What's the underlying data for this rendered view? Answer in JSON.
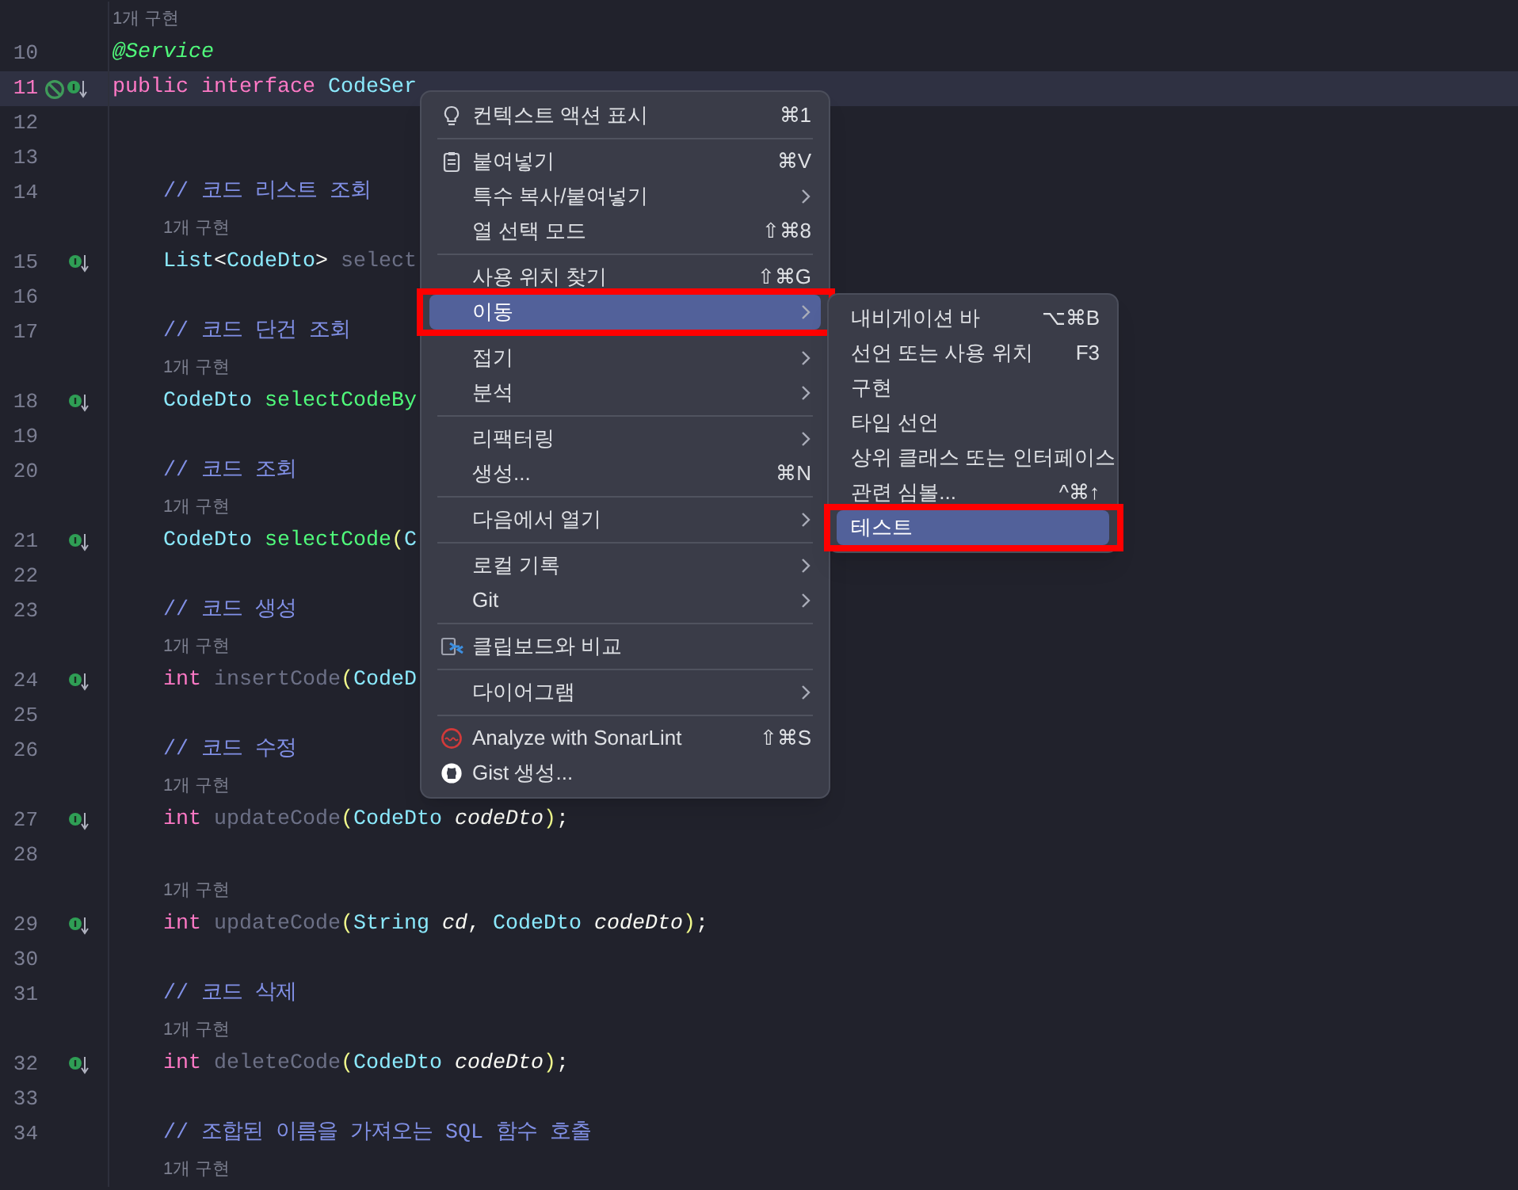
{
  "editor": {
    "rows": [
      {
        "kind": "hint",
        "text": "1개 구현"
      },
      {
        "kind": "code",
        "number": "10",
        "tokens": [
          {
            "kind": "annotation",
            "text": "@Service"
          }
        ]
      },
      {
        "kind": "code",
        "number": "11",
        "current": true,
        "gutter_icons": [
          {
            "kind": "blocked"
          },
          {
            "kind": "implemented"
          }
        ],
        "tokens": [
          {
            "kind": "keyword",
            "text": "public "
          },
          {
            "kind": "keyword",
            "text": "interface "
          },
          {
            "kind": "type",
            "text": "CodeSer"
          }
        ],
        "children": [
          {
            "kind": "code",
            "number": "12"
          },
          {
            "kind": "code",
            "number": "13"
          },
          {
            "kind": "code",
            "number": "14",
            "tokens": [
              {
                "kind": "comment",
                "text": "// 코드 리스트 조회"
              }
            ]
          },
          {
            "kind": "hint",
            "text": "1개 구현"
          },
          {
            "kind": "code",
            "number": "15",
            "gutter_icons": [
              {
                "kind": "implemented"
              }
            ],
            "tokens": [
              {
                "kind": "type",
                "text": "List"
              },
              {
                "kind": "plain",
                "text": "<"
              },
              {
                "kind": "type",
                "text": "CodeDto"
              },
              {
                "kind": "plain",
                "text": "> "
              },
              {
                "kind": "unused",
                "text": "select"
              }
            ]
          },
          {
            "kind": "code",
            "number": "16"
          },
          {
            "kind": "code",
            "number": "17",
            "tokens": [
              {
                "kind": "comment",
                "text": "// 코드 단건 조회"
              }
            ]
          },
          {
            "kind": "hint",
            "text": "1개 구현"
          },
          {
            "kind": "code",
            "number": "18",
            "gutter_icons": [
              {
                "kind": "implemented"
              }
            ],
            "tokens": [
              {
                "kind": "type",
                "text": "CodeDto "
              },
              {
                "kind": "method",
                "text": "selectCodeBy"
              }
            ]
          },
          {
            "kind": "code",
            "number": "19"
          },
          {
            "kind": "code",
            "number": "20",
            "tokens": [
              {
                "kind": "comment",
                "text": "// 코드 조회"
              }
            ]
          },
          {
            "kind": "hint",
            "text": "1개 구현"
          },
          {
            "kind": "code",
            "number": "21",
            "gutter_icons": [
              {
                "kind": "implemented"
              }
            ],
            "tokens": [
              {
                "kind": "type",
                "text": "CodeDto "
              },
              {
                "kind": "method",
                "text": "selectCode"
              },
              {
                "kind": "paren",
                "text": "("
              },
              {
                "kind": "type",
                "text": "C"
              }
            ]
          },
          {
            "kind": "code",
            "number": "22"
          },
          {
            "kind": "code",
            "number": "23",
            "tokens": [
              {
                "kind": "comment",
                "text": "// 코드 생성"
              }
            ]
          },
          {
            "kind": "hint",
            "text": "1개 구현"
          },
          {
            "kind": "code",
            "number": "24",
            "gutter_icons": [
              {
                "kind": "implemented"
              }
            ],
            "tokens": [
              {
                "kind": "keyword",
                "text": "int "
              },
              {
                "kind": "unused",
                "text": "insertCode"
              },
              {
                "kind": "paren",
                "text": "("
              },
              {
                "kind": "type",
                "text": "CodeD"
              }
            ]
          },
          {
            "kind": "code",
            "number": "25"
          },
          {
            "kind": "code",
            "number": "26",
            "tokens": [
              {
                "kind": "comment",
                "text": "// 코드 수정"
              }
            ]
          },
          {
            "kind": "hint",
            "text": "1개 구현"
          },
          {
            "kind": "code",
            "number": "27",
            "gutter_icons": [
              {
                "kind": "implemented"
              }
            ],
            "tokens": [
              {
                "kind": "keyword",
                "text": "int "
              },
              {
                "kind": "unused",
                "text": "updateCode"
              },
              {
                "kind": "paren",
                "text": "("
              },
              {
                "kind": "type",
                "text": "CodeDto "
              },
              {
                "kind": "param",
                "text": "codeDto"
              },
              {
                "kind": "paren",
                "text": ")"
              },
              {
                "kind": "plain",
                "text": ";"
              }
            ]
          },
          {
            "kind": "code",
            "number": "28"
          },
          {
            "kind": "hint",
            "text": "1개 구현"
          },
          {
            "kind": "code",
            "number": "29",
            "gutter_icons": [
              {
                "kind": "implemented"
              }
            ],
            "tokens": [
              {
                "kind": "keyword",
                "text": "int "
              },
              {
                "kind": "unused",
                "text": "updateCode"
              },
              {
                "kind": "paren",
                "text": "("
              },
              {
                "kind": "type",
                "text": "String "
              },
              {
                "kind": "param",
                "text": "cd"
              },
              {
                "kind": "plain",
                "text": ", "
              },
              {
                "kind": "type",
                "text": "CodeDto "
              },
              {
                "kind": "param",
                "text": "codeDto"
              },
              {
                "kind": "paren",
                "text": ")"
              },
              {
                "kind": "plain",
                "text": ";"
              }
            ]
          },
          {
            "kind": "code",
            "number": "30"
          },
          {
            "kind": "code",
            "number": "31",
            "tokens": [
              {
                "kind": "comment",
                "text": "// 코드 삭제"
              }
            ]
          },
          {
            "kind": "hint",
            "text": "1개 구현"
          },
          {
            "kind": "code",
            "number": "32",
            "gutter_icons": [
              {
                "kind": "implemented"
              }
            ],
            "tokens": [
              {
                "kind": "keyword",
                "text": "int "
              },
              {
                "kind": "unused",
                "text": "deleteCode"
              },
              {
                "kind": "paren",
                "text": "("
              },
              {
                "kind": "type",
                "text": "CodeDto "
              },
              {
                "kind": "param",
                "text": "codeDto"
              },
              {
                "kind": "paren",
                "text": ")"
              },
              {
                "kind": "plain",
                "text": ";"
              }
            ]
          },
          {
            "kind": "code",
            "number": "33"
          },
          {
            "kind": "code",
            "number": "34",
            "tokens": [
              {
                "kind": "comment",
                "text": "// 조합된 이름을 가져오는 SQL 함수 호출"
              }
            ]
          },
          {
            "kind": "hint",
            "text": "1개 구현"
          }
        ]
      }
    ]
  },
  "context_menu": {
    "items": [
      {
        "kind": "item",
        "label": "컨텍스트 액션 표시",
        "shortcut": "⌘1",
        "submenu": false,
        "selected": false,
        "outlined": false
      },
      {
        "kind": "separator"
      },
      {
        "kind": "item",
        "label": "붙여넣기",
        "shortcut": "⌘V",
        "submenu": false,
        "selected": false,
        "outlined": false
      },
      {
        "kind": "item",
        "label": "특수 복사/붙여넣기",
        "submenu": true,
        "selected": false,
        "outlined": false
      },
      {
        "kind": "item",
        "label": "열 선택 모드",
        "shortcut": "⇧⌘8",
        "submenu": false,
        "selected": false,
        "outlined": false
      },
      {
        "kind": "separator"
      },
      {
        "kind": "item",
        "label": "사용 위치 찾기",
        "shortcut": "⇧⌘G",
        "submenu": false,
        "selected": false,
        "outlined": false
      },
      {
        "kind": "item",
        "label": "이동",
        "submenu": true,
        "selected": true,
        "outlined": true
      },
      {
        "kind": "separator"
      },
      {
        "kind": "item",
        "label": "접기",
        "submenu": true,
        "selected": false,
        "outlined": false
      },
      {
        "kind": "item",
        "label": "분석",
        "submenu": true,
        "selected": false,
        "outlined": false
      },
      {
        "kind": "separator"
      },
      {
        "kind": "item",
        "label": "리팩터링",
        "submenu": true,
        "selected": false,
        "outlined": false
      },
      {
        "kind": "item",
        "label": "생성...",
        "shortcut": "⌘N",
        "submenu": false,
        "selected": false,
        "outlined": false
      },
      {
        "kind": "separator"
      },
      {
        "kind": "item",
        "label": "다음에서 열기",
        "submenu": true,
        "selected": false,
        "outlined": false
      },
      {
        "kind": "separator"
      },
      {
        "kind": "item",
        "label": "로컬 기록",
        "submenu": true,
        "selected": false,
        "outlined": false
      },
      {
        "kind": "item",
        "label": "Git",
        "submenu": true,
        "selected": false,
        "outlined": false
      },
      {
        "kind": "separator"
      },
      {
        "kind": "item",
        "label": "클립보드와 비교",
        "submenu": false,
        "selected": false,
        "outlined": false
      },
      {
        "kind": "separator"
      },
      {
        "kind": "item",
        "label": "다이어그램",
        "submenu": true,
        "selected": false,
        "outlined": false
      },
      {
        "kind": "separator"
      },
      {
        "kind": "item",
        "label": "Analyze with SonarLint",
        "shortcut": "⇧⌘S",
        "submenu": false,
        "selected": false,
        "outlined": false
      },
      {
        "kind": "item",
        "label": "Gist 생성...",
        "submenu": false,
        "selected": false,
        "outlined": false
      }
    ]
  },
  "submenu": {
    "items": [
      {
        "kind": "item",
        "label": "내비게이션 바",
        "shortcut": "⌥⌘B",
        "selected": false,
        "outlined": false
      },
      {
        "kind": "item",
        "label": "선언 또는 사용 위치",
        "shortcut": "F3",
        "selected": false,
        "outlined": false
      },
      {
        "kind": "item",
        "label": "구현",
        "selected": false,
        "outlined": false
      },
      {
        "kind": "item",
        "label": "타입 선언",
        "selected": false,
        "outlined": false
      },
      {
        "kind": "item",
        "label": "상위 클래스 또는 인터페이스",
        "selected": false,
        "outlined": false
      },
      {
        "kind": "item",
        "label": "관련 심볼...",
        "shortcut": "^⌘↑",
        "selected": false,
        "outlined": false
      },
      {
        "kind": "item",
        "label": "테스트",
        "selected": true,
        "outlined": true
      }
    ]
  }
}
